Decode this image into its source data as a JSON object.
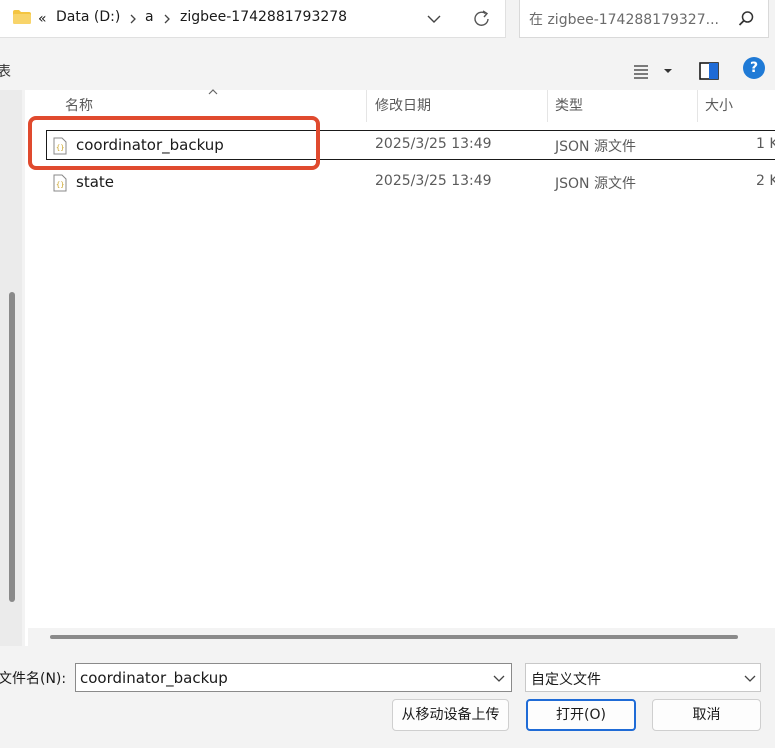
{
  "address_bar": {
    "overflow": "«",
    "crumbs": [
      "Data (D:)",
      "a",
      "zigbee-1742881793278"
    ]
  },
  "search": {
    "placeholder": "在 zigbee-174288179327..."
  },
  "toolbar": {
    "fragment": "表",
    "help": "?"
  },
  "columns": {
    "name": "名称",
    "date": "修改日期",
    "type": "类型",
    "size": "大小"
  },
  "files": [
    {
      "name": "coordinator_backup",
      "date": "2025/3/25 13:49",
      "type": "JSON 源文件",
      "size": "1 K"
    },
    {
      "name": "state",
      "date": "2025/3/25 13:49",
      "type": "JSON 源文件",
      "size": "2 K"
    }
  ],
  "bottom": {
    "filename_label": "文件名(N):",
    "filename_value": "coordinator_backup",
    "filetype_value": "自定义文件",
    "upload_label": "从移动设备上传",
    "open_label": "打开(O)",
    "cancel_label": "取消"
  },
  "colors": {
    "accent": "#1f6bd6",
    "annotation": "#e04a2e",
    "folder": "#f4c542"
  },
  "icons": [
    "folder-icon",
    "chevron-right-icon",
    "chevron-down-icon",
    "refresh-icon",
    "search-icon",
    "view-list-icon",
    "preview-pane-icon",
    "help-icon",
    "json-file-icon",
    "sort-up-icon"
  ]
}
